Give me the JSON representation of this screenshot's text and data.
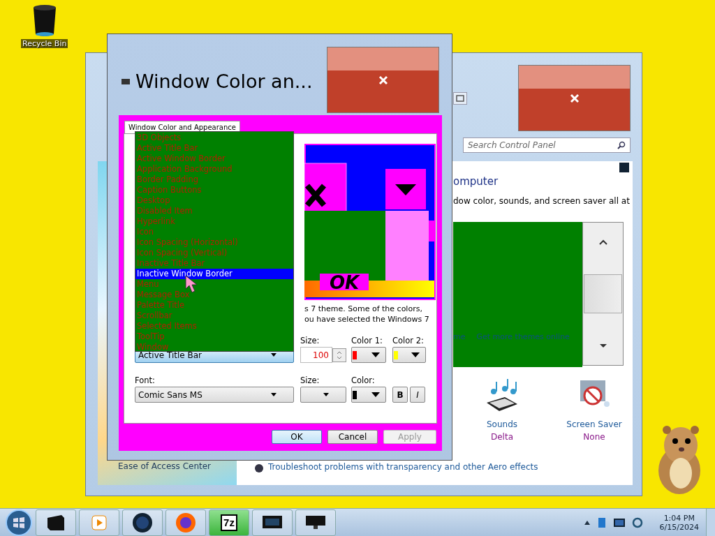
{
  "desktop_icons": [
    {
      "label": "Recycle Bin"
    }
  ],
  "control_panel": {
    "search": {
      "placeholder": "Search Control Panel"
    },
    "heading": "omputer",
    "description": "dow color, sounds, and screen saver all at",
    "theme_links": [
      {
        "label": "me"
      },
      {
        "label": "Get more themes online"
      }
    ],
    "items": [
      {
        "kind": "sounds",
        "label": "Sounds",
        "value": "Delta"
      },
      {
        "kind": "screensaver",
        "label": "Screen Saver",
        "value": "None"
      }
    ],
    "sidebar_link": "Ease of Access Center",
    "troubleshoot_link": "Troubleshoot problems with transparency and other Aero effects"
  },
  "dialog": {
    "title": "Window Color an...",
    "tab": {
      "label": "Window Color and Appearance",
      "selected": true
    },
    "preview_button": "OK",
    "note": [
      "s 7 theme.  Some of the colors,",
      "ou have selected the Windows 7"
    ],
    "item_list": [
      {
        "label": "3D Objects",
        "selected": false
      },
      {
        "label": "Active Title Bar",
        "selected": false
      },
      {
        "label": "Active Window Border",
        "selected": false
      },
      {
        "label": "Application Background",
        "selected": false
      },
      {
        "label": "Border Padding",
        "selected": false
      },
      {
        "label": "Caption Buttons",
        "selected": false
      },
      {
        "label": "Desktop",
        "selected": false
      },
      {
        "label": "Disabled Item",
        "selected": false
      },
      {
        "label": "Hyperlink",
        "selected": false
      },
      {
        "label": "Icon",
        "selected": false
      },
      {
        "label": "Icon Spacing (Horizontal)",
        "selected": false
      },
      {
        "label": "Icon Spacing (Vertical)",
        "selected": false
      },
      {
        "label": "Inactive Title Bar",
        "selected": false
      },
      {
        "label": "Inactive Window Border",
        "selected": true
      },
      {
        "label": "Menu",
        "selected": false
      },
      {
        "label": "Message Box",
        "selected": false
      },
      {
        "label": "Palette Title",
        "selected": false
      },
      {
        "label": "Scrollbar",
        "selected": false
      },
      {
        "label": "Selected Items",
        "selected": false
      },
      {
        "label": "ToolTip",
        "selected": false
      },
      {
        "label": "Window",
        "selected": false
      }
    ],
    "item": {
      "value": "Active Title Bar"
    },
    "item_size": {
      "label": "Size:",
      "value": "100"
    },
    "color_1": {
      "label": "Color 1:",
      "color": "#ff0000"
    },
    "color_2": {
      "label": "Color 2:",
      "color": "#ffff00"
    },
    "font": {
      "label": "Font:",
      "value": "Comic Sans MS"
    },
    "font_size": {
      "label": "Size:"
    },
    "font_color": {
      "label": "Color:",
      "color": "#000000"
    },
    "style_buttons": [
      {
        "label": "B",
        "kind": "bold"
      },
      {
        "label": "I",
        "kind": "italic"
      }
    ],
    "buttons": [
      {
        "label": "OK",
        "disabled": false
      },
      {
        "label": "Cancel",
        "disabled": false
      },
      {
        "label": "Apply",
        "disabled": true
      }
    ]
  },
  "taskbar": {
    "apps": [
      {
        "kind": "drive",
        "selected": false
      },
      {
        "kind": "media",
        "selected": false
      },
      {
        "kind": "globe",
        "selected": false
      },
      {
        "kind": "firefox",
        "selected": false
      },
      {
        "kind": "archiver",
        "label": "7z",
        "selected": true
      },
      {
        "kind": "monitor",
        "selected": false
      },
      {
        "kind": "display",
        "selected": false
      }
    ],
    "time": "1:04 PM",
    "date": "6/15/2024"
  }
}
